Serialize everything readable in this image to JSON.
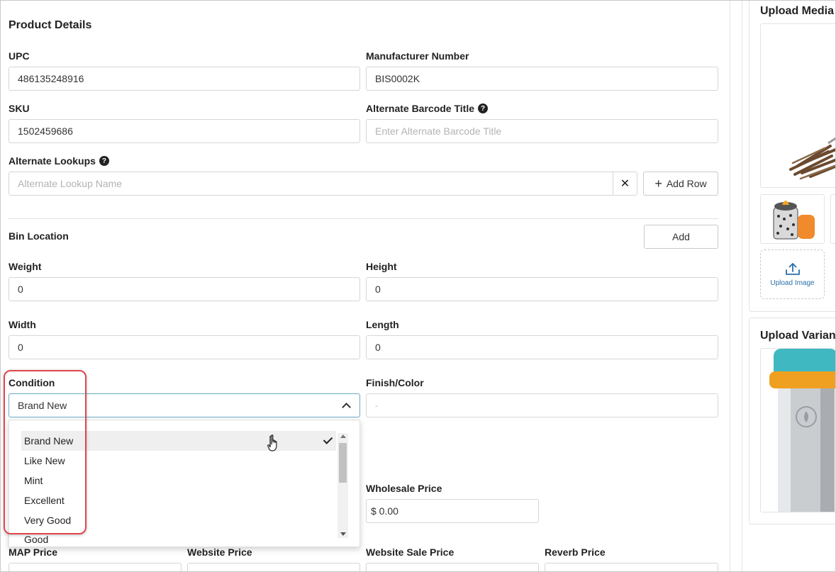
{
  "section": {
    "title": "Product Details"
  },
  "fields": {
    "upc": {
      "label": "UPC",
      "value": "486135248916"
    },
    "manufacturer_number": {
      "label": "Manufacturer Number",
      "value": "BIS0002K"
    },
    "sku": {
      "label": "SKU",
      "value": "1502459686"
    },
    "alternate_barcode_title": {
      "label": "Alternate Barcode Title",
      "placeholder": "Enter Alternate Barcode Title"
    },
    "alternate_lookups": {
      "label": "Alternate Lookups",
      "placeholder": "Alternate Lookup Name",
      "clear": "✕",
      "add_row": "Add Row"
    },
    "bin_location": {
      "label": "Bin Location",
      "add": "Add"
    },
    "weight": {
      "label": "Weight",
      "value": "0"
    },
    "height": {
      "label": "Height",
      "value": "0"
    },
    "width": {
      "label": "Width",
      "value": "0"
    },
    "length": {
      "label": "Length",
      "value": "0"
    },
    "condition": {
      "label": "Condition",
      "value": "Brand New",
      "options": [
        "Brand New",
        "Like New",
        "Mint",
        "Excellent",
        "Very Good",
        "Good"
      ]
    },
    "finish_color": {
      "label": "Finish/Color",
      "placeholder": "-"
    },
    "wholesale_price": {
      "label": "Wholesale Price",
      "value": "$ 0.00"
    },
    "map_price": {
      "label": "MAP Price"
    },
    "website_price": {
      "label": "Website Price"
    },
    "website_sale_price": {
      "label": "Website Sale Price"
    },
    "reverb_price": {
      "label": "Reverb Price"
    }
  },
  "help_glyph": "?",
  "plus_glyph": "+",
  "right_panel": {
    "upload_media_title": "Upload Media",
    "upload_image_label": "Upload Image",
    "upload_variant_title": "Upload Variant"
  },
  "colors": {
    "highlight": "#e0464d",
    "focus_border": "#6aa7c7",
    "link": "#2a6fa8"
  }
}
